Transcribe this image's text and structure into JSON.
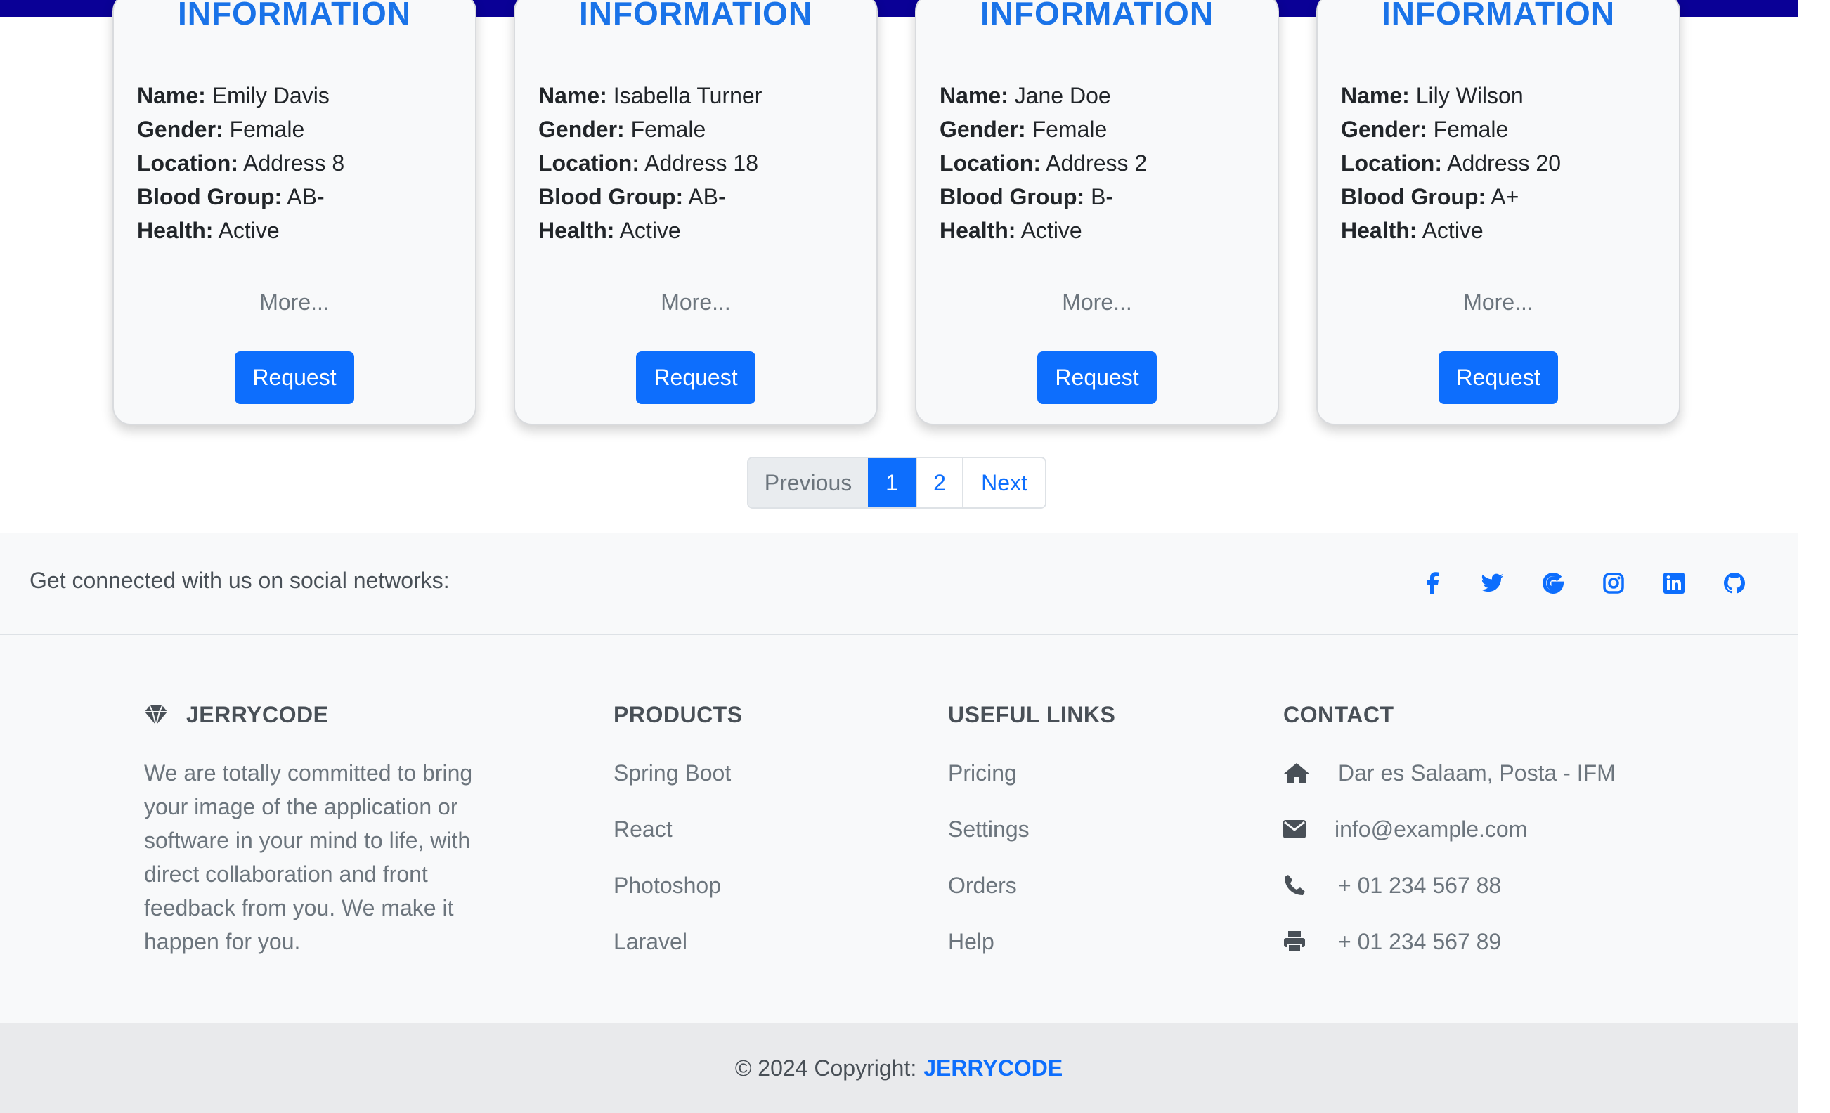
{
  "cards": [
    {
      "title": "INFORMATION",
      "name_label": "Name:",
      "name": "Emily Davis",
      "gender_label": "Gender:",
      "gender": "Female",
      "location_label": "Location:",
      "location": "Address 8",
      "blood_label": "Blood Group:",
      "blood": "AB-",
      "health_label": "Health:",
      "health": "Active",
      "more": "More...",
      "button": "Request"
    },
    {
      "title": "INFORMATION",
      "name_label": "Name:",
      "name": "Isabella Turner",
      "gender_label": "Gender:",
      "gender": "Female",
      "location_label": "Location:",
      "location": "Address 18",
      "blood_label": "Blood Group:",
      "blood": "AB-",
      "health_label": "Health:",
      "health": "Active",
      "more": "More...",
      "button": "Request"
    },
    {
      "title": "INFORMATION",
      "name_label": "Name:",
      "name": "Jane Doe",
      "gender_label": "Gender:",
      "gender": "Female",
      "location_label": "Location:",
      "location": "Address 2",
      "blood_label": "Blood Group:",
      "blood": "B-",
      "health_label": "Health:",
      "health": "Active",
      "more": "More...",
      "button": "Request"
    },
    {
      "title": "INFORMATION",
      "name_label": "Name:",
      "name": "Lily Wilson",
      "gender_label": "Gender:",
      "gender": "Female",
      "location_label": "Location:",
      "location": "Address 20",
      "blood_label": "Blood Group:",
      "blood": "A+",
      "health_label": "Health:",
      "health": "Active",
      "more": "More...",
      "button": "Request"
    }
  ],
  "pagination": {
    "previous": "Previous",
    "pages": [
      "1",
      "2"
    ],
    "active_page": "1",
    "next": "Next"
  },
  "social": {
    "text": "Get connected with us on social networks:",
    "icons": [
      "facebook-icon",
      "twitter-icon",
      "google-icon",
      "instagram-icon",
      "linkedin-icon",
      "github-icon"
    ]
  },
  "footer": {
    "brand": "JERRYCODE",
    "description": "We are totally committed to bring your image of the application or software in your mind to life, with direct collaboration and front feedback from you. We make it happen for you.",
    "products": {
      "heading": "PRODUCTS",
      "items": [
        "Spring Boot",
        "React",
        "Photoshop",
        "Laravel"
      ]
    },
    "useful_links": {
      "heading": "USEFUL LINKS",
      "items": [
        "Pricing",
        "Settings",
        "Orders",
        "Help"
      ]
    },
    "contact": {
      "heading": "CONTACT",
      "address": "Dar es Salaam, Posta - IFM",
      "email": "info@example.com",
      "phone": "+ 01 234 567 88",
      "fax": "+ 01 234 567 89"
    }
  },
  "copyright": {
    "text": "© 2024 Copyright:",
    "brand": "JERRYCODE"
  },
  "colors": {
    "accent": "#0d6efd",
    "topbar": "#0a0096",
    "card_title": "#1a73e8"
  }
}
